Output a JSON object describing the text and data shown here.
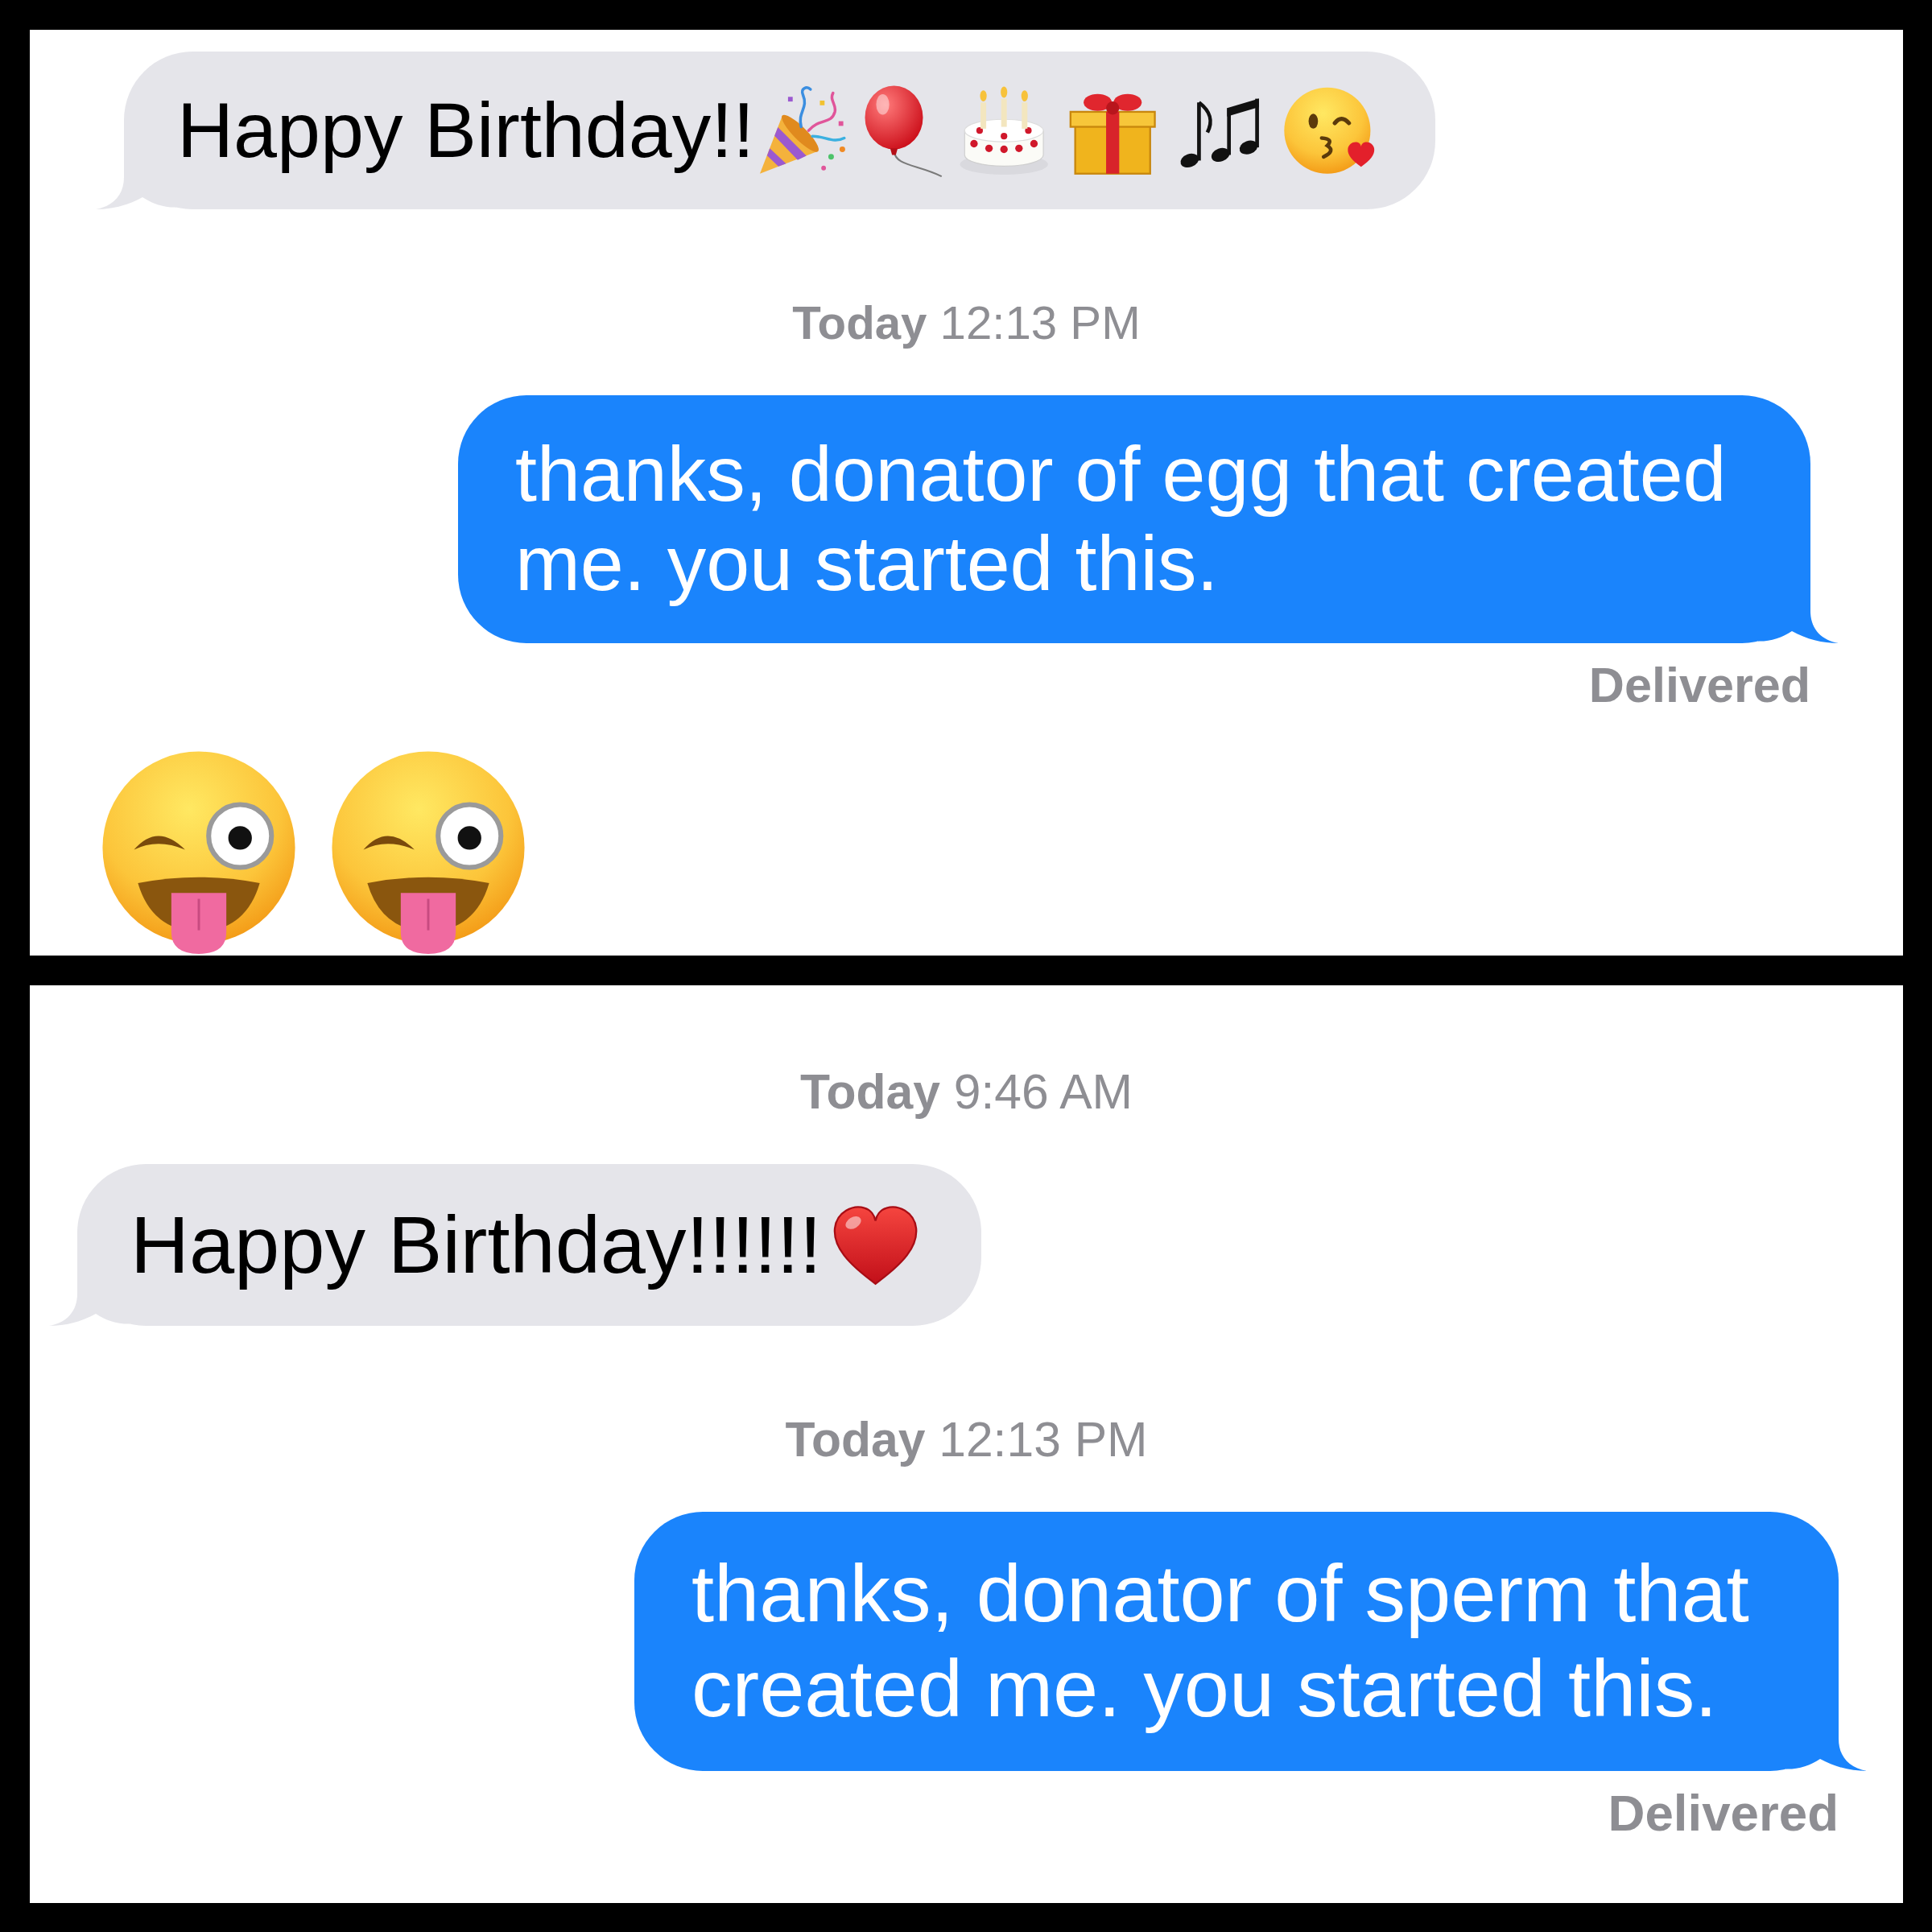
{
  "panels": [
    {
      "messages": [
        {
          "kind": "incoming",
          "parts": [
            {
              "kind": "text",
              "text": "Happy Birthday!!"
            },
            {
              "kind": "popper"
            },
            {
              "kind": "balloon"
            },
            {
              "kind": "cake"
            },
            {
              "kind": "gift"
            },
            {
              "kind": "notes"
            },
            {
              "kind": "kiss"
            }
          ]
        },
        {
          "kind": "timestamp",
          "text": "**Today** 12:13 PM"
        },
        {
          "kind": "outgoing",
          "parts": [
            {
              "kind": "text",
              "text": "thanks, donator of egg that created me. you started this."
            }
          ],
          "status": "Delivered"
        },
        {
          "kind": "jumbo",
          "parts": [
            {
              "kind": "tongue"
            },
            {
              "kind": "tongue"
            }
          ]
        }
      ]
    },
    {
      "messages": [
        {
          "kind": "timestamp",
          "text": "**Today** 9:46 AM"
        },
        {
          "kind": "incoming",
          "parts": [
            {
              "kind": "text",
              "text": "Happy Birthday!!!!!!"
            },
            {
              "kind": "heart"
            }
          ]
        },
        {
          "kind": "timestamp",
          "text": "**Today** 12:13 PM"
        },
        {
          "kind": "outgoing",
          "parts": [
            {
              "kind": "text",
              "text": "thanks, donator of sperm that created me. you started this."
            }
          ],
          "status": "Delivered"
        }
      ]
    }
  ]
}
